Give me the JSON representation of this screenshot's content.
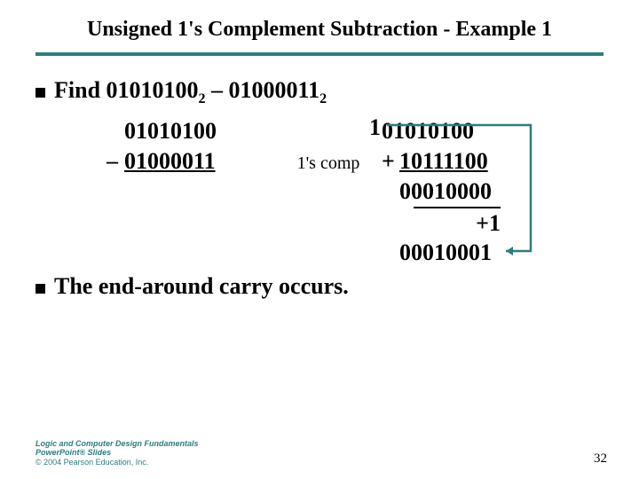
{
  "title": "Unsigned 1's Complement Subtraction - Example 1",
  "bullet1_prefix": "Find ",
  "bullet1_a": "01010100",
  "bullet1_sub_a": "2",
  "bullet1_mid": " – ",
  "bullet1_b": "01000011",
  "bullet1_sub_b": "2",
  "math": {
    "carry": "1",
    "r1_left": "01010100",
    "r1_right": "01010100",
    "minus": "–",
    "r2_left": "01000011",
    "comp_label": "1's comp",
    "plus": "+",
    "r2_right": "10111100",
    "r3_right": "00010000",
    "plus_one": "+1",
    "result": "00010001"
  },
  "bullet2": "The end-around carry occurs.",
  "footer": {
    "line1": "Logic and Computer Design Fundamentals",
    "line2": "PowerPoint® Slides",
    "line3": "© 2004 Pearson Education, Inc."
  },
  "page": "32"
}
